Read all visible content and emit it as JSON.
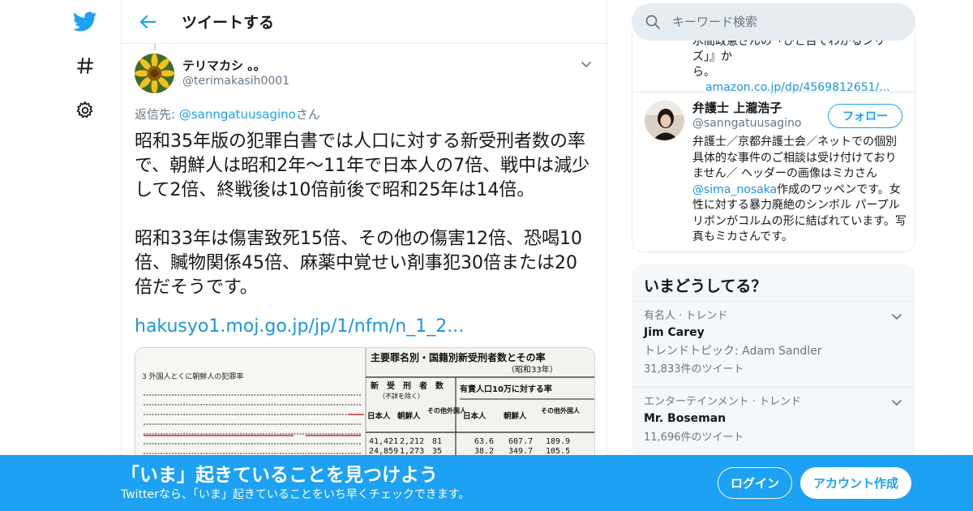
{
  "nav": {
    "icons": [
      "twitter-logo",
      "hashtag-icon",
      "gear-icon"
    ]
  },
  "header": {
    "title": "ツイートする"
  },
  "tweet": {
    "display_name": "テリマカシ 。。",
    "handle": "@terimakasih0001",
    "reply_prefix": "返信先: ",
    "reply_handle": "@sanngatuusagino",
    "reply_suffix": "さん",
    "paragraph1": "昭和35年版の犯罪白書では人口に対する新受刑者数の率で、朝鮮人は昭和2年〜11年で日本人の7倍、戦中は減少して2倍、終戦後は10倍前後で昭和25年は14倍。",
    "paragraph2": "昭和33年は傷害致死15倍、その他の傷害12倍、恐喝10倍、贓物関係45倍、麻薬中覚せい剤事犯30倍または20倍だそうです。",
    "link": "hakusyo1.moj.go.jp/jp/1/nfm/n_1_2..."
  },
  "media": {
    "doc_heading": "3 外国人とくに朝鮮人の犯罪率",
    "table_title": "主要罪名別・国籍別新受刑者数とその率",
    "table_year": "（昭和33年）",
    "col_group1": "新　受　刑　者　数",
    "col_group1_note": "（不詳を除く）",
    "col_group2": "有責人口10万に対する率",
    "cols": [
      "日本人",
      "朝鮮人",
      "その他外国人",
      "日本人",
      "朝鮮人",
      "その他外国人"
    ],
    "rows": [
      [
        "41,421",
        "2,212",
        "81",
        "63.6",
        "607.7",
        "189.9"
      ],
      [
        "24,859",
        "1,273",
        "35",
        "38.2",
        "349.7",
        "105.5"
      ]
    ]
  },
  "search": {
    "placeholder": "キーワード検索"
  },
  "prev_snippet": {
    "line1": "水間政憲さんの「ひと目でわかるシリー",
    "line2": "ズ」』か",
    "line3": "ら。",
    "link": "amazon.co.jp/dp/4569812651/..."
  },
  "profile_card": {
    "name": "弁護士 上瀧浩子",
    "handle": "@sanngatuusagino",
    "follow_label": "フォロー",
    "bio_part1": "弁護士／京都弁護士会／ネットでの個別具体的な事件のご相談は受け付けておりません／ ヘッダーの画像はミカさん",
    "bio_mention": "@sima_nosaka",
    "bio_part2": "作成のワッペンです。女性に対する暴力廃絶のシンボル パープルリボンがコルムの形に結ばれています。写真もミカさんです。"
  },
  "trends": {
    "title": "いまどうしてる？",
    "items": [
      {
        "meta": "有名人 · トレンド",
        "name": "Jim Carey",
        "sub": "トレンドトピック: Adam Sandler",
        "count": "31,833件のツイート"
      },
      {
        "meta": "エンターテインメント · トレンド",
        "name": "Mr. Boseman",
        "count": "11,696件のツイート"
      }
    ]
  },
  "banner": {
    "title": "「いま」起きていることを見つけよう",
    "subtitle": "Twitterなら、「いま」起きていることをいち早くチェックできます。",
    "login_label": "ログイン",
    "signup_label": "アカウント作成"
  },
  "colors": {
    "brand": "#1da1f2",
    "link": "#1b95e0",
    "muted": "#657786"
  }
}
